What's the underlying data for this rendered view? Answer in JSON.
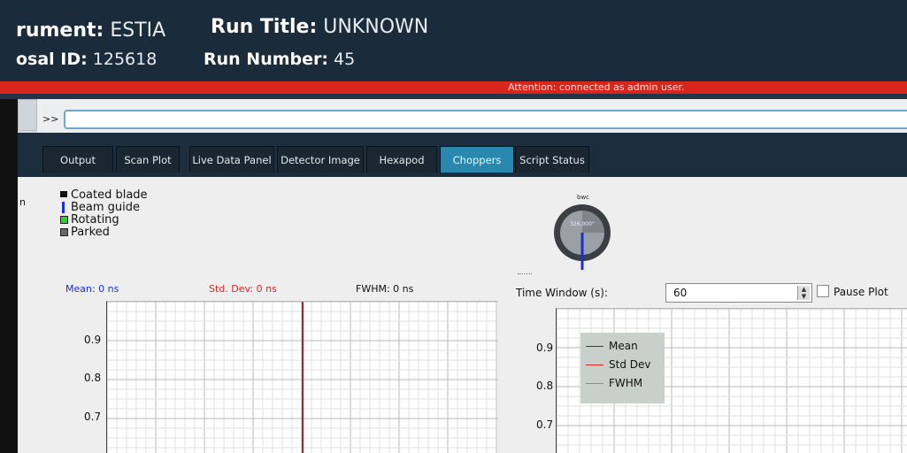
{
  "header": {
    "instrument_label": "rument:",
    "instrument_value": "ESTIA",
    "run_title_label": "Run Title:",
    "run_title_value": "UNKNOWN",
    "proposal_label": "osal ID:",
    "proposal_value": "125618",
    "run_number_label": "Run Number:",
    "run_number_value": "45"
  },
  "attention": "Attention: connected as admin user.",
  "command": {
    "prompt": ">>",
    "value": ""
  },
  "tabs": [
    {
      "label": "Output",
      "active": false
    },
    {
      "label": "Scan Plot",
      "active": false
    },
    {
      "label": "Live Data Panel",
      "active": false
    },
    {
      "label": "Detector Image",
      "active": false
    },
    {
      "label": "Hexapod",
      "active": false
    },
    {
      "label": "Choppers",
      "active": true
    },
    {
      "label": "Script Status",
      "active": false
    }
  ],
  "sidebar": {
    "label": "n"
  },
  "legend": [
    {
      "label": "Coated blade",
      "color": "#111111",
      "shape": "bar"
    },
    {
      "label": "Beam guide",
      "color": "#1a2fd6",
      "shape": "line"
    },
    {
      "label": "Rotating",
      "color": "#2bd22b",
      "shape": "square"
    },
    {
      "label": "Parked",
      "color": "#666666",
      "shape": "square"
    }
  ],
  "chopper": {
    "name": "bwc",
    "angle_text": "326.000°",
    "angle": 326
  },
  "stats": {
    "mean": "Mean: 0 ns",
    "std_dev": "Std. Dev: 0 ns",
    "fwhm": "FWHM: 0 ns",
    "mean_color": "#1b2fd3",
    "std_color": "#d62626",
    "fwhm_color": "#111111"
  },
  "time_window": {
    "label": "Time Window (s):",
    "value": "60"
  },
  "pause_plot": {
    "label": "Pause Plot",
    "checked": false
  },
  "left_plot": {
    "yticks": [
      "0.9",
      "0.8",
      "0.7"
    ]
  },
  "right_plot": {
    "yticks": [
      "0.9",
      "0.8",
      "0.7"
    ],
    "legend": [
      {
        "label": "Mean",
        "color": "#1b2fd3"
      },
      {
        "label": "Std Dev",
        "color": "#d62626"
      },
      {
        "label": "FWHM",
        "color": "#2bd22b"
      }
    ]
  }
}
